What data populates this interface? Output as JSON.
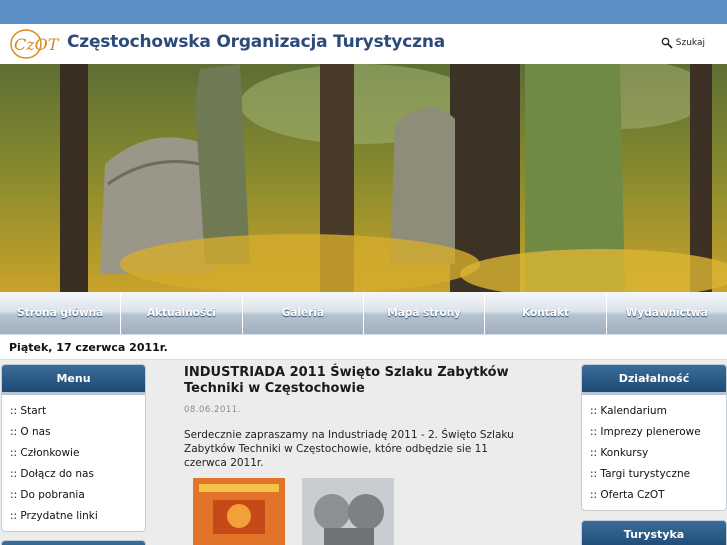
{
  "header": {
    "title": "Częstochowska Organizacja Turystyczna",
    "logo_text": "CzOT",
    "search_label": "Szukaj"
  },
  "nav": {
    "items": [
      "Strona główna",
      "Aktualności",
      "Galeria",
      "Mapa strony",
      "Kontakt",
      "Wydawnictwa"
    ]
  },
  "date": "Piątek, 17 czerwca 2011r.",
  "left_menu": {
    "title": "Menu",
    "items": [
      ":: Start",
      ":: O nas",
      ":: Członkowie",
      ":: Dołącz do nas",
      ":: Do pobrania",
      ":: Przydatne linki"
    ]
  },
  "right_menu": {
    "title": "Działalność",
    "items": [
      ":: Kalendarium",
      ":: Imprezy plenerowe",
      ":: Konkursy",
      ":: Targi turystyczne",
      ":: Oferta CzOT"
    ]
  },
  "right_menu2": {
    "title": "Turystyka"
  },
  "article": {
    "title": "INDUSTRIADA 2011 Święto Szlaku Zabytków Techniki w Częstochowie",
    "date": "08.06.2011.",
    "body": "Serdecznie zapraszamy na Industriadę 2011 - 2. Święto Szlaku Zabytków Techniki w Częstochowie, które odbędzie sie 11 czerwca 2011r."
  },
  "colors": {
    "brand_blue": "#2c4a7a",
    "page_bg": "#5b8fc6",
    "box_header": "#1e4a73"
  }
}
